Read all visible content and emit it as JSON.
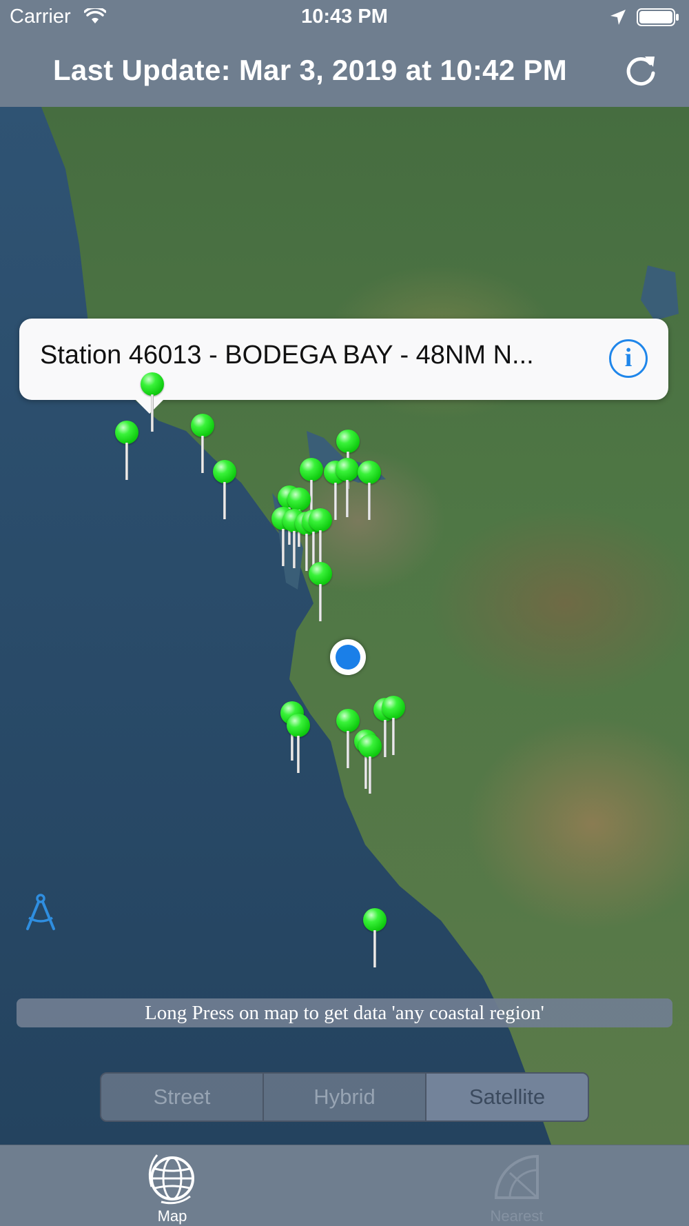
{
  "status_bar": {
    "carrier": "Carrier",
    "time": "10:43 PM",
    "icons": [
      "wifi-icon",
      "location-arrow-icon",
      "battery-icon"
    ]
  },
  "header": {
    "title": "Last Update: Mar 3, 2019 at 10:42 PM",
    "refresh_icon": "refresh-icon"
  },
  "map": {
    "callout": {
      "title": "Station 46013 - BODEGA BAY - 48NM N...",
      "info_icon": "info-icon",
      "info_glyph": "i"
    },
    "pin_color": "#14d414",
    "user_location_color": "#1a7fe8",
    "hint": "Long Press on map to get data 'any coastal region'",
    "compass_icon": "drafting-compass-icon",
    "map_types": {
      "options": [
        "Street",
        "Hybrid",
        "Satellite"
      ],
      "selected": "Satellite"
    }
  },
  "tab_bar": {
    "tabs": [
      {
        "label": "Map",
        "icon": "globe-icon",
        "selected": true
      },
      {
        "label": "Nearest",
        "icon": "protractor-icon",
        "selected": false
      }
    ]
  }
}
